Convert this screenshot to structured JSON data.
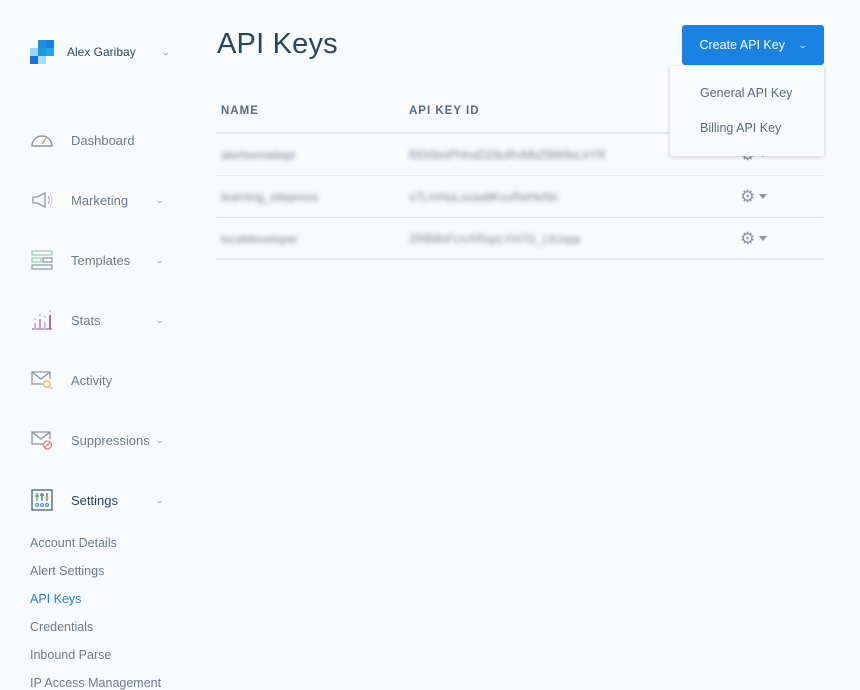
{
  "account": {
    "name": "Alex Garibay",
    "chevron_icon": "chevron-down-icon"
  },
  "sidebar": {
    "items": [
      {
        "label": "Dashboard",
        "icon": "dashboard-gauge-icon",
        "has_chevron": false
      },
      {
        "label": "Marketing",
        "icon": "megaphone-icon",
        "has_chevron": true
      },
      {
        "label": "Templates",
        "icon": "templates-icon",
        "has_chevron": true
      },
      {
        "label": "Stats",
        "icon": "stats-chart-icon",
        "has_chevron": true
      },
      {
        "label": "Activity",
        "icon": "mail-search-icon",
        "has_chevron": false
      },
      {
        "label": "Suppressions",
        "icon": "mail-blocked-icon",
        "has_chevron": true
      },
      {
        "label": "Settings",
        "icon": "settings-sliders-icon",
        "has_chevron": true,
        "expanded": true
      }
    ],
    "settings_subitems": [
      {
        "label": "Account Details",
        "active": false
      },
      {
        "label": "Alert Settings",
        "active": false
      },
      {
        "label": "API Keys",
        "active": true
      },
      {
        "label": "Credentials",
        "active": false
      },
      {
        "label": "Inbound Parse",
        "active": false
      },
      {
        "label": "IP Access Management",
        "active": false
      }
    ]
  },
  "page": {
    "title": "API Keys"
  },
  "create_button": {
    "label": "Create API Key",
    "menu": [
      "General API Key",
      "Billing API Key"
    ]
  },
  "table": {
    "columns": [
      "NAME",
      "API KEY ID"
    ],
    "rows": [
      {
        "name": "[redacted]",
        "id": "[redacted]",
        "name_ph": "alertsemailapi",
        "id_ph": "f0G0bnPHnsDZ8uRvMbZ9W9sLkYR"
      },
      {
        "name": "[redacted]",
        "id": "[redacted]",
        "name_ph": "learning_sitepress",
        "id_ph": "s7LmHuLsxaa8KsvReHeNn"
      },
      {
        "name": "[redacted]",
        "id": "[redacted]",
        "name_ph": "localdeveloper",
        "id_ph": "ZRB8hFUvXRspLYH7G_LtUxpp"
      }
    ]
  },
  "colors": {
    "accent": "#1a82e2",
    "active_link": "#1a82e2",
    "text_dark": "#294661",
    "text_muted": "#6b7c8e",
    "background": "#f9fafc"
  }
}
